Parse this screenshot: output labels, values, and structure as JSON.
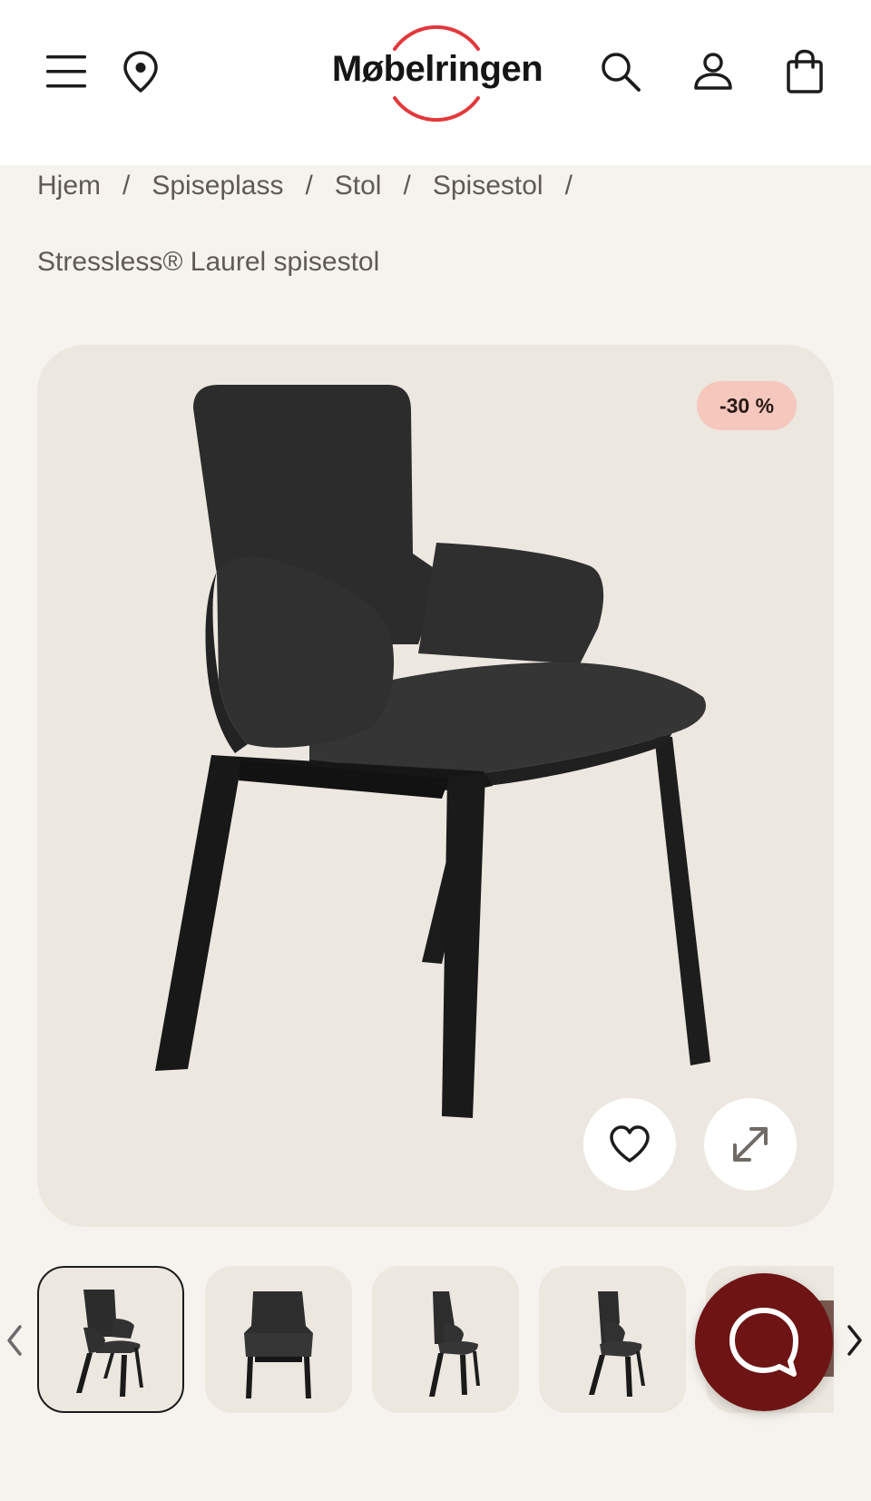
{
  "header": {
    "logo_text": "Møbelringen",
    "icons": [
      "menu-icon",
      "location-pin-icon",
      "search-icon",
      "user-icon",
      "shopping-bag-icon"
    ],
    "logo_ring_color": "#e3383c"
  },
  "breadcrumb": {
    "items": [
      {
        "label": "Hjem"
      },
      {
        "label": "Spiseplass"
      },
      {
        "label": "Stol"
      },
      {
        "label": "Spisestol"
      }
    ],
    "separator": "/",
    "current": "Stressless® Laurel spisestol"
  },
  "product": {
    "discount_badge": "-30 %",
    "image_icons": [
      "heart-icon",
      "expand-icon"
    ]
  },
  "thumbnails": {
    "count_visible": 5,
    "active_index": 0
  },
  "chat": {
    "icon": "chat-bubble-icon",
    "color": "#6e1414"
  }
}
